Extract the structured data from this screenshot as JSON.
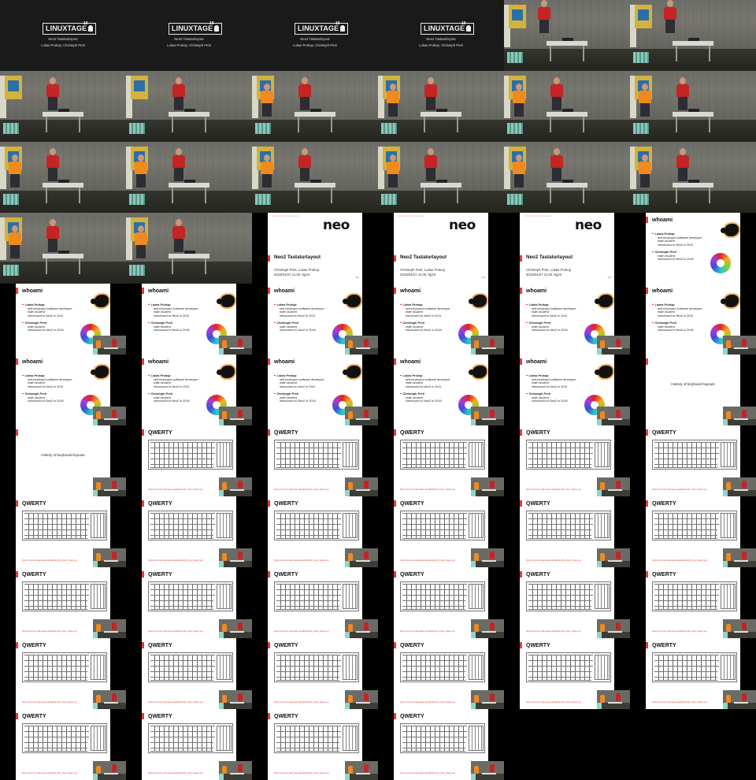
{
  "title_card": {
    "logo_text": "LINUXTAGE",
    "year": "19",
    "talk_title": "Neo2 Tastaturlayout",
    "speakers": "Lukas Prokop, Christoph Preti"
  },
  "neo_slide": {
    "url_hint": "https://www.ccc.de/neo-layout",
    "logo": "neo",
    "title": "Neo2 Tastaturlayout",
    "authors": "Christoph Preti, Lukas Prokop",
    "date_venue": "2019/04/27 11:00, ltg19",
    "page": "1/89"
  },
  "whoami_slide": {
    "heading": "whoami",
    "person1": {
      "name": "Lukas Prokop",
      "lines": [
        "self-employed software developer",
        "math student",
        "introduced to Neo2 in 2011"
      ]
    },
    "person2": {
      "name": "Christoph Preti",
      "lines": [
        "math student",
        "introduced to Neo2 in 2018"
      ]
    },
    "page": "2/89"
  },
  "history_slide": {
    "text": "History of keyboard layouts"
  },
  "qwerty_slide": {
    "heading": "QWERTY",
    "url": "https://commons.wikimedia.org/wiki/File:KB_United_States.svg"
  }
}
